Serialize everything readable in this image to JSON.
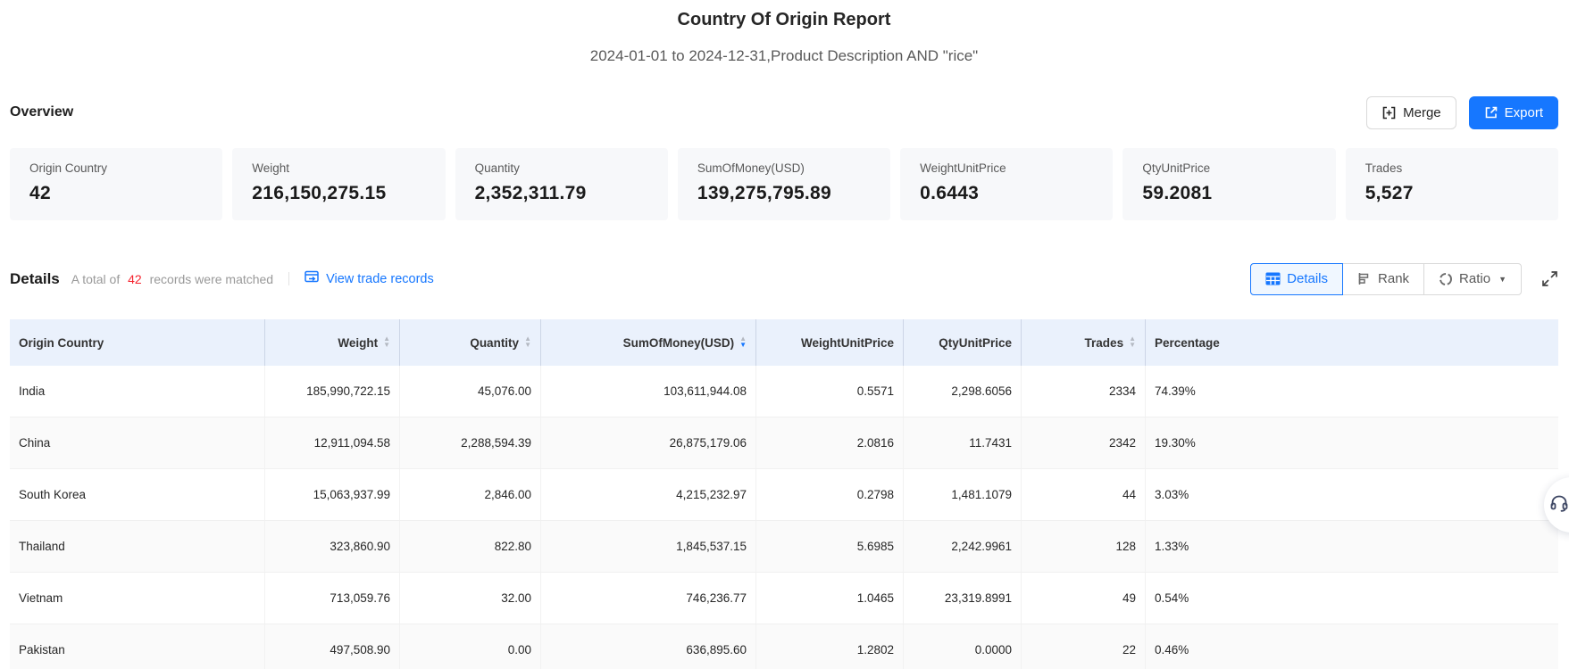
{
  "report": {
    "title": "Country Of Origin Report",
    "subtitle": "2024-01-01 to 2024-12-31,Product Description AND \"rice\""
  },
  "overview": {
    "heading": "Overview",
    "merge_label": "Merge",
    "export_label": "Export",
    "cards": [
      {
        "label": "Origin Country",
        "value": "42"
      },
      {
        "label": "Weight",
        "value": "216,150,275.15"
      },
      {
        "label": "Quantity",
        "value": "2,352,311.79"
      },
      {
        "label": "SumOfMoney(USD)",
        "value": "139,275,795.89"
      },
      {
        "label": "WeightUnitPrice",
        "value": "0.6443"
      },
      {
        "label": "QtyUnitPrice",
        "value": "59.2081"
      },
      {
        "label": "Trades",
        "value": "5,527"
      }
    ]
  },
  "details": {
    "heading": "Details",
    "total_prefix": "A total of",
    "total_count": "42",
    "total_suffix": "records were matched",
    "view_trade_records_label": "View trade records",
    "tabs": [
      {
        "label": "Details",
        "icon": "table-icon",
        "active": true,
        "dropdown": false
      },
      {
        "label": "Rank",
        "icon": "bar-chart-icon",
        "active": false,
        "dropdown": false
      },
      {
        "label": "Ratio",
        "icon": "donut-icon",
        "active": false,
        "dropdown": true
      }
    ]
  },
  "table": {
    "columns": [
      {
        "label": "Origin Country",
        "align": "left",
        "sortable": false,
        "sort": null
      },
      {
        "label": "Weight",
        "align": "right",
        "sortable": true,
        "sort": null
      },
      {
        "label": "Quantity",
        "align": "right",
        "sortable": true,
        "sort": null
      },
      {
        "label": "SumOfMoney(USD)",
        "align": "right",
        "sortable": true,
        "sort": "desc"
      },
      {
        "label": "WeightUnitPrice",
        "align": "right",
        "sortable": false,
        "sort": null
      },
      {
        "label": "QtyUnitPrice",
        "align": "right",
        "sortable": false,
        "sort": null
      },
      {
        "label": "Trades",
        "align": "right",
        "sortable": true,
        "sort": null
      },
      {
        "label": "Percentage",
        "align": "left",
        "sortable": false,
        "sort": null
      }
    ],
    "rows": [
      [
        "India",
        "185,990,722.15",
        "45,076.00",
        "103,611,944.08",
        "0.5571",
        "2,298.6056",
        "2334",
        "74.39%"
      ],
      [
        "China",
        "12,911,094.58",
        "2,288,594.39",
        "26,875,179.06",
        "2.0816",
        "11.7431",
        "2342",
        "19.30%"
      ],
      [
        "South Korea",
        "15,063,937.99",
        "2,846.00",
        "4,215,232.97",
        "0.2798",
        "1,481.1079",
        "44",
        "3.03%"
      ],
      [
        "Thailand",
        "323,860.90",
        "822.80",
        "1,845,537.15",
        "5.6985",
        "2,242.9961",
        "128",
        "1.33%"
      ],
      [
        "Vietnam",
        "713,059.76",
        "32.00",
        "746,236.77",
        "1.0465",
        "23,319.8991",
        "49",
        "0.54%"
      ],
      [
        "Pakistan",
        "497,508.90",
        "0.00",
        "636,895.60",
        "1.2802",
        "0.0000",
        "22",
        "0.46%"
      ]
    ]
  },
  "colors": {
    "accent_blue": "#1677ff",
    "count_red": "#f5222d",
    "table_header_bg": "#eaf1fc",
    "row_stripe": "#fafafa",
    "card_bg": "#f7f8fa"
  }
}
